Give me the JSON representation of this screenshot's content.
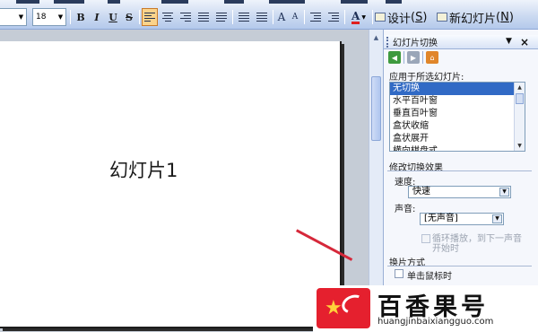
{
  "toolbar": {
    "font_size": "18",
    "bold": "B",
    "italic": "I",
    "underline": "U",
    "shadow": "S",
    "font_color": "A",
    "grow_font": "A",
    "shrink_font": "A",
    "design_label": "设计",
    "design_hotkey": "S",
    "new_slide_label": "新幻灯片",
    "new_slide_hotkey": "N"
  },
  "slide": {
    "title": "幻灯片1"
  },
  "task_pane": {
    "title": "幻灯片切换",
    "apply_label": "应用于所选幻灯片:",
    "transitions": [
      "无切换",
      "水平百叶窗",
      "垂直百叶窗",
      "盒状收缩",
      "盒状展开",
      "横向棋盘式"
    ],
    "selected_index": 0,
    "modify_section": "修改切换效果",
    "speed_label": "速度:",
    "speed_value": "快速",
    "sound_label": "声音:",
    "sound_value": "[无声音]",
    "loop_line1": "循环播放，到下一声音",
    "loop_line2": "开始时",
    "advance_section": "换片方式",
    "on_click_label": "单击鼠标时"
  },
  "watermark": {
    "name": "百香果号",
    "url": "huangjinbaixiangguo.com"
  },
  "colors": {
    "selection": "#316ac5",
    "toolbar_active": "#fbd38b",
    "watermark_red": "#e5202e"
  }
}
